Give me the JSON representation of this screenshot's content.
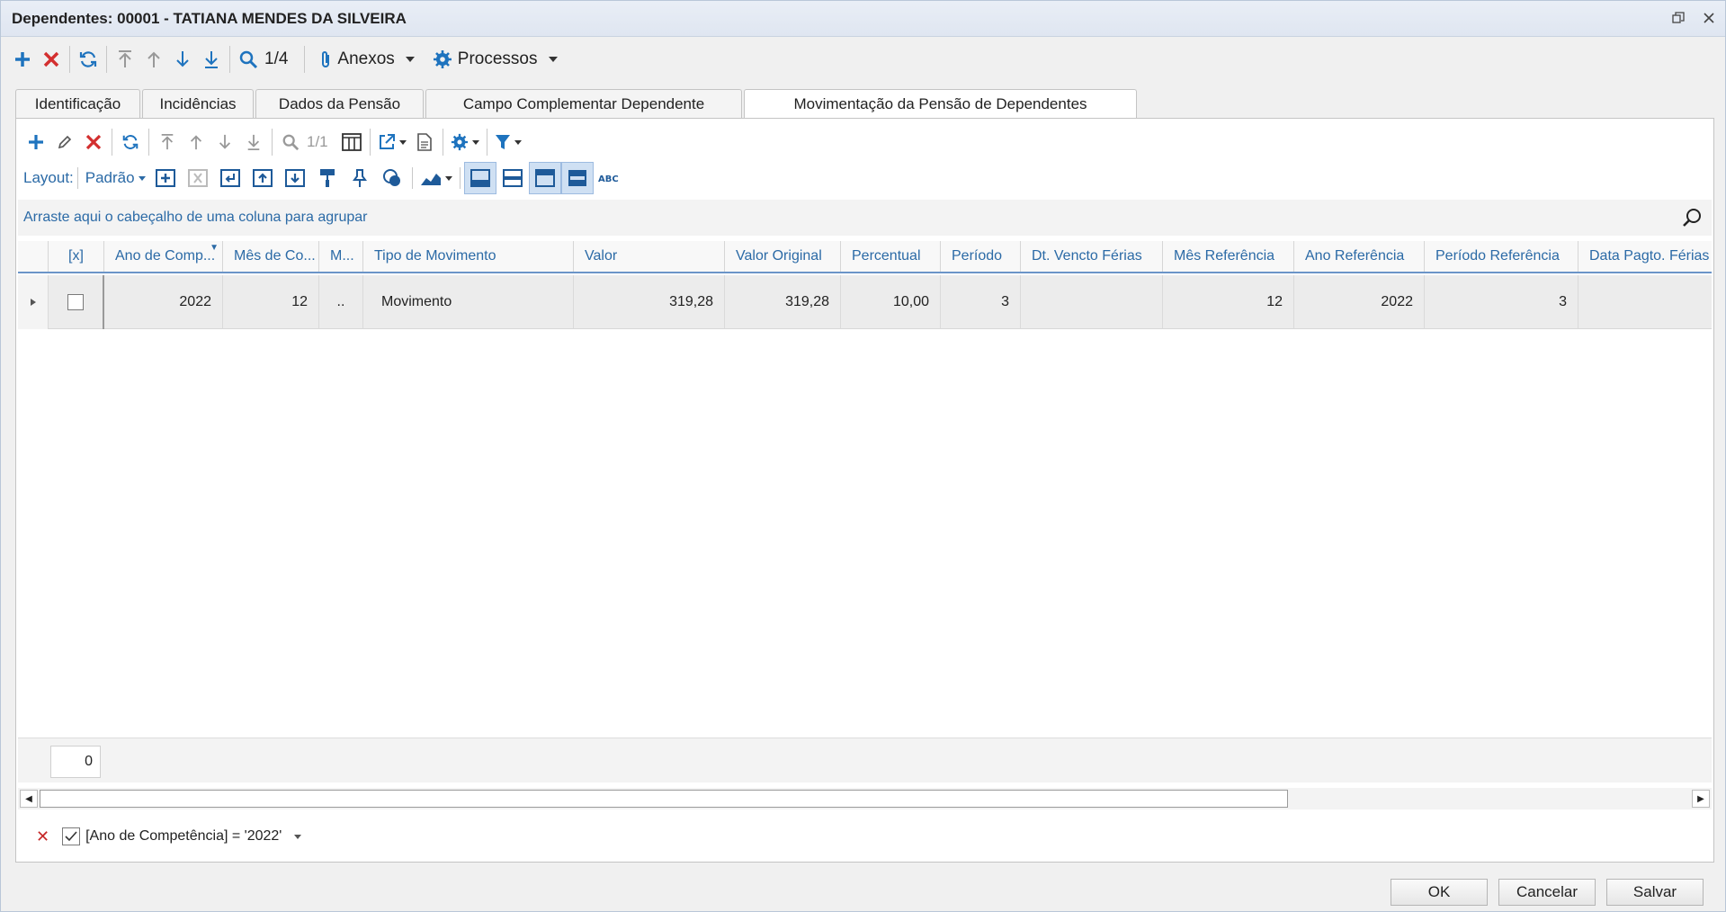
{
  "window": {
    "title": "Dependentes: 00001 - TATIANA MENDES DA SILVEIRA"
  },
  "toolbar": {
    "record_counter": "1/4",
    "anexos_label": "Anexos",
    "processos_label": "Processos"
  },
  "tabs": [
    {
      "label": "Identificação"
    },
    {
      "label": "Incidências"
    },
    {
      "label": "Dados da Pensão"
    },
    {
      "label": "Campo Complementar Dependente"
    },
    {
      "label": "Movimentação da Pensão de Dependentes"
    }
  ],
  "grid_toolbar": {
    "record_counter": "1/1",
    "layout_label": "Layout:",
    "layout_value": "Padrão"
  },
  "group_bar": {
    "text": "Arraste aqui o cabeçalho de uma coluna para agrupar"
  },
  "grid": {
    "columns": [
      "[x]",
      "Ano de Comp...",
      "Mês de Co...",
      "M...",
      "Tipo de Movimento",
      "Valor",
      "Valor Original",
      "Percentual",
      "Período",
      "Dt. Vencto Férias",
      "Mês Referência",
      "Ano Referência",
      "Período Referência",
      "Data Pagto. Férias"
    ],
    "rows": [
      {
        "ano_comp": "2022",
        "mes_comp": "12",
        "m": "..",
        "tipo_movimento": "Movimento",
        "valor": "319,28",
        "valor_original": "319,28",
        "percentual": "10,00",
        "periodo": "3",
        "dt_vencto_ferias": "",
        "mes_referencia": "12",
        "ano_referencia": "2022",
        "periodo_referencia": "3",
        "data_pagto_ferias": ""
      }
    ]
  },
  "footer": {
    "count": "0"
  },
  "filter": {
    "text": "[Ano de Competência] = '2022'"
  },
  "buttons": {
    "ok": "OK",
    "cancel": "Cancelar",
    "save": "Salvar"
  },
  "colors": {
    "accent": "#2b6aa6",
    "add": "#1e73be",
    "delete": "#d32f2f",
    "header_text": "#2b6aa6"
  }
}
